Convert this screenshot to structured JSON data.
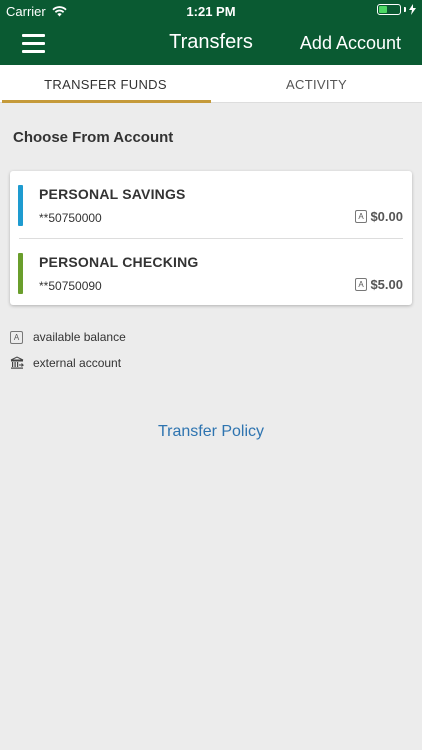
{
  "status_bar": {
    "carrier": "Carrier",
    "time": "1:21 PM",
    "battery_level": 0.4,
    "battery_color": "#4cd964"
  },
  "nav": {
    "title": "Transfers",
    "add_account": "Add Account",
    "background_color": "#0a5a32",
    "menu_icon": "hamburger-icon"
  },
  "tabs": [
    {
      "label": "TRANSFER FUNDS",
      "active": true
    },
    {
      "label": "ACTIVITY",
      "active": false
    }
  ],
  "section_title": "Choose From Account",
  "accounts": [
    {
      "name": "PERSONAL SAVINGS",
      "number": "**50750000",
      "badge": "A",
      "balance": "$0.00",
      "color": "#1e9bd0"
    },
    {
      "name": "PERSONAL CHECKING",
      "number": "**50750090",
      "badge": "A",
      "balance": "$5.00",
      "color": "#6a9e2c"
    }
  ],
  "legend": {
    "available_badge": "A",
    "available_label": "available balance",
    "external_icon": "bank-icon",
    "external_label": "external account"
  },
  "transfer_policy": "Transfer Policy",
  "accent_color": "#c59a3a",
  "link_color": "#2e74b0"
}
